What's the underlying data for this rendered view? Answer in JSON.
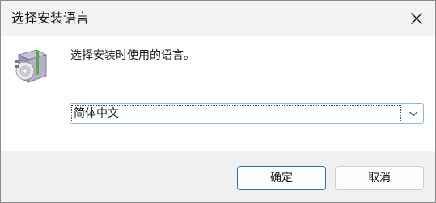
{
  "window": {
    "title": "选择安装语言",
    "close_icon": "close-icon"
  },
  "main": {
    "icon": "installer-package-icon",
    "prompt": "选择安装时使用的语言。",
    "language_select": {
      "value": "简体中文",
      "arrow_icon": "chevron-down-icon"
    }
  },
  "buttons": {
    "ok_label": "确定",
    "cancel_label": "取消"
  },
  "colors": {
    "accent_border": "#2f6fb3",
    "titlebar_bg": "#f3f3f3",
    "footer_bg": "#f0f0f0"
  }
}
